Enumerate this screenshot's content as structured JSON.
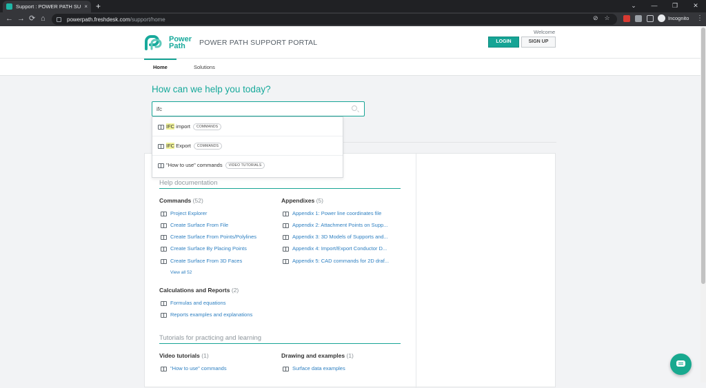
{
  "browser": {
    "tab_title": "Support : POWER PATH SUPPORT",
    "tab_close": "×",
    "new_tab": "+",
    "url_host": "powerpath.freshdesk.com",
    "url_path": "/support/home",
    "profile": "Incognito",
    "window_controls": [
      "⌄",
      "—",
      "❐",
      "✕"
    ]
  },
  "header": {
    "brand_line1": "Power",
    "brand_line2": "Path",
    "portal_title": "POWER PATH SUPPORT PORTAL",
    "welcome": "Welcome",
    "login": "LOGIN",
    "signup": "SIGN UP",
    "accent_color": "#16a495"
  },
  "subnav": {
    "home": "Home",
    "solutions": "Solutions"
  },
  "hero": {
    "title": "How can we help you today?",
    "search_value": "ifc"
  },
  "suggestions": [
    {
      "highlight": "IFC",
      "rest": " import",
      "badge": "COMMANDS"
    },
    {
      "highlight": "IFC",
      "rest": " Export",
      "badge": "COMMANDS"
    },
    {
      "highlight": "",
      "rest": "\"How to use\" commands",
      "badge": "VIDEO TUTORIALS"
    }
  ],
  "help": {
    "section_title": "Help documentation",
    "commands": {
      "name": "Commands",
      "count": "(52)",
      "articles": [
        "Project Explorer",
        "Create Surface From File",
        "Create Surface From Points/Polylines",
        "Create Surface By Placing Points",
        "Create Surface From 3D Faces"
      ],
      "view_all": "View all 52"
    },
    "appendixes": {
      "name": "Appendixes",
      "count": "(5)",
      "articles": [
        "Appendix 1: Power line coordinates file",
        "Appendix 2: Attachment Points on Supp...",
        "Appendix 3: 3D Models of Supports and...",
        "Appendix 4: Import/Export Conductor D...",
        "Appendix 5: CAD commands for 2D draf..."
      ]
    },
    "calculations": {
      "name": "Calculations and Reports",
      "count": "(2)",
      "articles": [
        "Formulas and equations",
        "Reports examples and explanations"
      ]
    }
  },
  "tutorials": {
    "section_title": "Tutorials for practicing and learning",
    "video": {
      "name": "Video tutorials",
      "count": "(1)",
      "articles": [
        "\"How to use\" commands"
      ]
    },
    "drawing": {
      "name": "Drawing and examples",
      "count": "(1)",
      "articles": [
        "Surface data examples"
      ]
    }
  }
}
